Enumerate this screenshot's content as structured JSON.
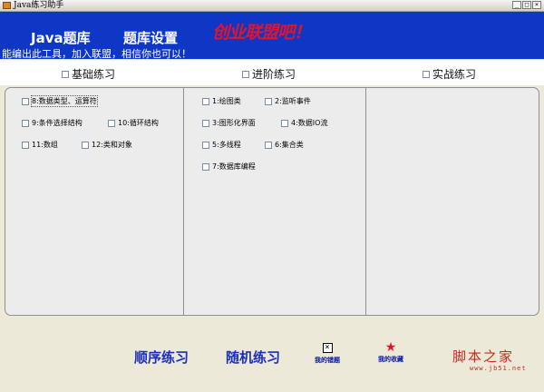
{
  "window": {
    "title": "Java练习助手",
    "minimize_glyph": "_",
    "maximize_glyph": "□",
    "close_glyph": "×"
  },
  "banner": {
    "menu": [
      "Java题库",
      "题库设置"
    ],
    "slogan_logo": "创业联盟吧！",
    "tagline": "能编出此工具，加入联盟，相信你也可以！"
  },
  "tabs": [
    "基础练习",
    "进阶练习",
    "实战练习"
  ],
  "columns": {
    "basic": [
      {
        "label": "8:数据类型、运算符",
        "checked": false
      },
      {
        "label": "9:条件选择结构",
        "checked": false
      },
      {
        "label": "10:循环结构",
        "checked": false
      },
      {
        "label": "11:数组",
        "checked": false
      },
      {
        "label": "12:类和对象",
        "checked": false
      }
    ],
    "advanced": [
      {
        "label": "1:绘图类",
        "checked": false
      },
      {
        "label": "2:监听事件",
        "checked": false
      },
      {
        "label": "3:图形化界面",
        "checked": false
      },
      {
        "label": "4:数据IO流",
        "checked": false
      },
      {
        "label": "5:多线程",
        "checked": false
      },
      {
        "label": "6:集合类",
        "checked": false
      },
      {
        "label": "7:数据库编程",
        "checked": false
      }
    ]
  },
  "actions": {
    "sequential": "顺序练习",
    "random": "随机练习",
    "wrong_label": "我的错题",
    "wrong_icon_glyph": "×",
    "favorites_label": "我的收藏",
    "favorites_icon_glyph": "★"
  },
  "watermark": {
    "title": "脚本之家",
    "url": "www.jb51.net"
  },
  "colors": {
    "banner": "#0e37c5",
    "accent_red": "#e3142a",
    "action_blue": "#1a2fb8"
  }
}
